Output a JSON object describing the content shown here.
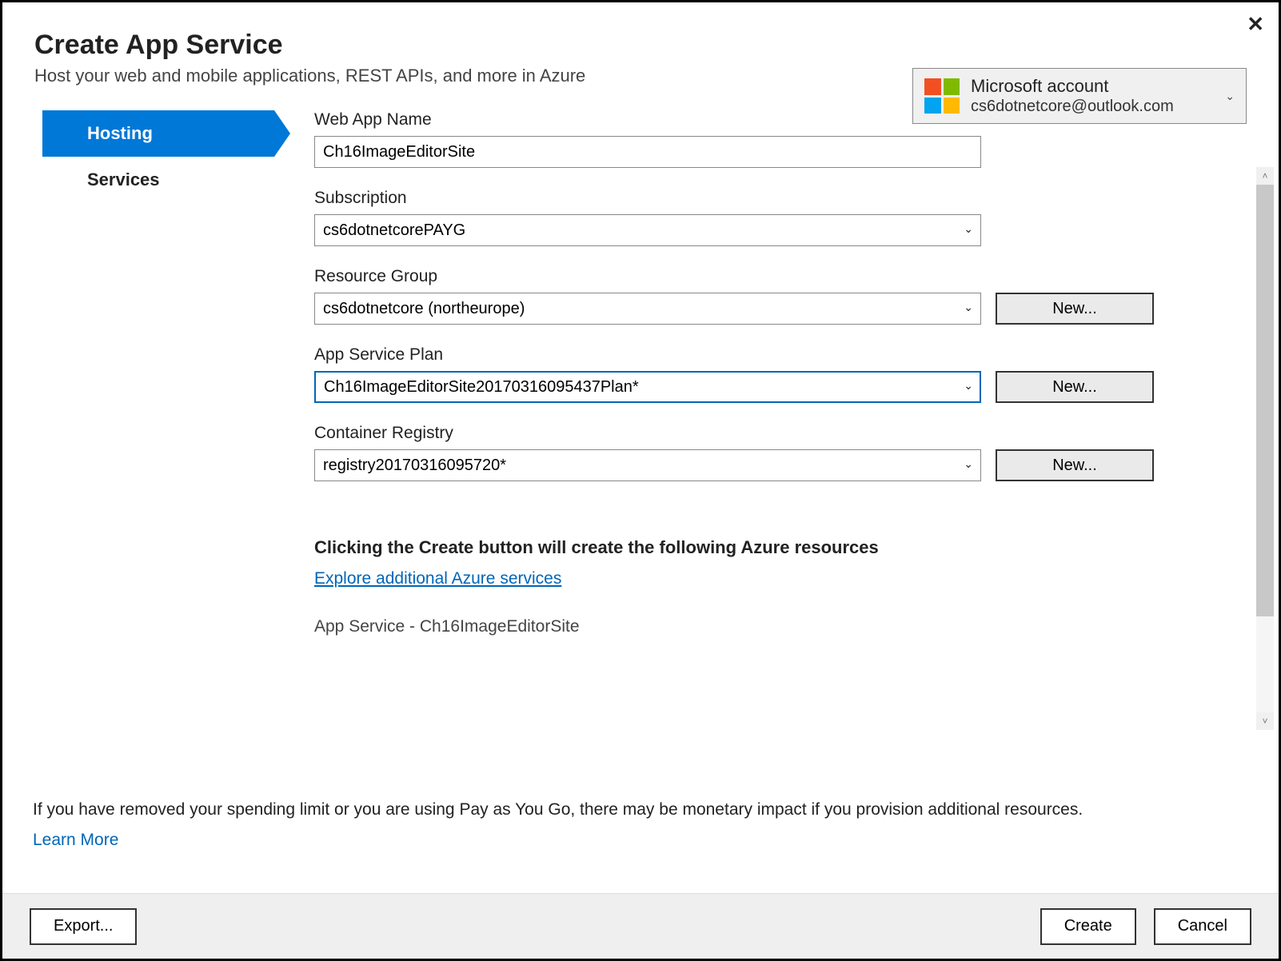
{
  "dialog": {
    "title": "Create App Service",
    "subtitle": "Host your web and mobile applications, REST APIs, and more in Azure"
  },
  "account": {
    "provider": "Microsoft account",
    "email": "cs6dotnetcore@outlook.com"
  },
  "tabs": {
    "hosting": "Hosting",
    "services": "Services"
  },
  "form": {
    "webAppName": {
      "label": "Web App Name",
      "value": "Ch16ImageEditorSite"
    },
    "subscription": {
      "label": "Subscription",
      "value": "cs6dotnetcorePAYG"
    },
    "resourceGroup": {
      "label": "Resource Group",
      "value": "cs6dotnetcore (northeurope)",
      "newLabel": "New..."
    },
    "appServicePlan": {
      "label": "App Service Plan",
      "value": "Ch16ImageEditorSite20170316095437Plan*",
      "newLabel": "New..."
    },
    "containerRegistry": {
      "label": "Container Registry",
      "value": "registry20170316095720*",
      "newLabel": "New..."
    }
  },
  "summary": {
    "heading": "Clicking the Create button will create the following Azure resources",
    "link": "Explore additional Azure services",
    "partial": "App Service - Ch16ImageEditorSite"
  },
  "footer": {
    "warning": "If you have removed your spending limit or you are using Pay as You Go, there may be monetary impact if you provision additional resources.",
    "learnMore": "Learn More",
    "export": "Export...",
    "create": "Create",
    "cancel": "Cancel"
  }
}
